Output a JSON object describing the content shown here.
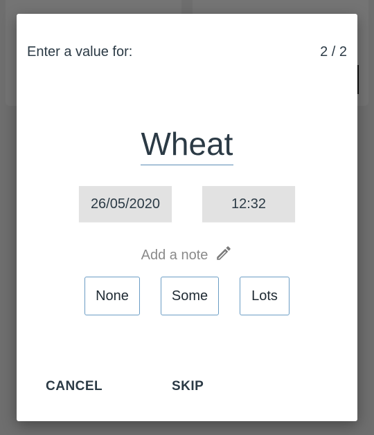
{
  "dialog": {
    "header_label": "Enter a value for:",
    "page_counter": "2 / 2",
    "item_name": "Wheat",
    "date_value": "26/05/2020",
    "time_value": "12:32",
    "note_placeholder": "Add a note",
    "note_icon": "pencil-icon",
    "options": [
      {
        "label": "None"
      },
      {
        "label": "Some"
      },
      {
        "label": "Lots"
      }
    ],
    "actions": {
      "cancel_label": "CANCEL",
      "skip_label": "SKIP"
    }
  },
  "colors": {
    "accent_underline": "#5a8bb5",
    "option_border": "#6a9cc4",
    "text_primary": "#2b3a45",
    "field_bg": "#e2e2e2",
    "scrim": "#6e6e6e"
  }
}
